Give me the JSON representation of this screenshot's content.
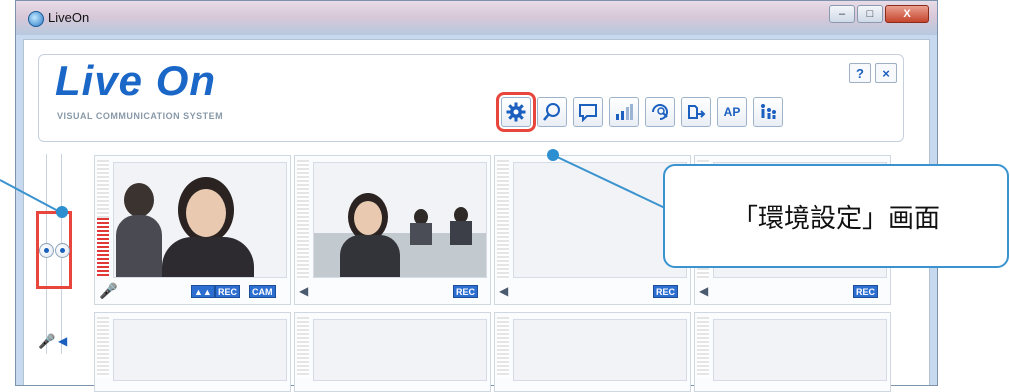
{
  "window": {
    "title": "LiveOn",
    "buttons": [
      "–",
      "□",
      "X"
    ]
  },
  "logo": {
    "name": "Live On",
    "tagline": "VISUAL COMMUNICATION SYSTEM"
  },
  "header_buttons": {
    "help": "?",
    "close": "×"
  },
  "toolbar": [
    {
      "name": "settings",
      "icon": "gear-icon",
      "label": ""
    },
    {
      "name": "search",
      "icon": "magnifier-icon",
      "label": ""
    },
    {
      "name": "whiteboard",
      "icon": "board-icon",
      "label": ""
    },
    {
      "name": "stats",
      "icon": "bar-chart-icon",
      "label": ""
    },
    {
      "name": "zoom",
      "icon": "zoom-icon",
      "label": ""
    },
    {
      "name": "share",
      "icon": "share-icon",
      "label": ""
    },
    {
      "name": "ap",
      "icon": "",
      "label": "AP"
    },
    {
      "name": "participants",
      "icon": "people-icon",
      "label": ""
    }
  ],
  "cells_row1": [
    {
      "tags": [
        "▲▲",
        "REC",
        "CAM"
      ],
      "has_mic": true
    },
    {
      "tags": [
        "REC"
      ],
      "has_mic": false
    },
    {
      "tags": [
        "REC"
      ],
      "has_mic": false
    },
    {
      "tags": [
        "REC"
      ],
      "has_mic": false
    }
  ],
  "callout": {
    "text": "「環境設定」画面"
  },
  "colors": {
    "brand": "#1b67c7",
    "highlight": "#e8453c",
    "callout": "#3a93cf"
  }
}
